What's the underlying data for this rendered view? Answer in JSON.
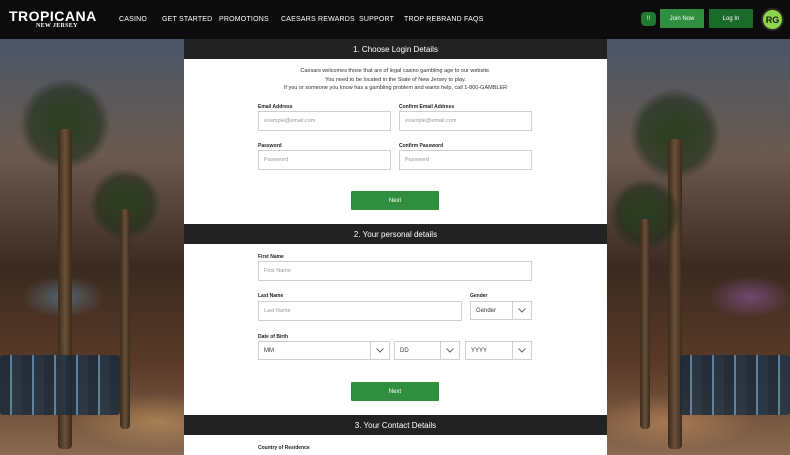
{
  "header": {
    "logo_text": "TROPICANA",
    "logo_subtext": "NEW JERSEY",
    "nav": [
      {
        "label": "CASINO"
      },
      {
        "label": "GET STARTED"
      },
      {
        "label": "PROMOTIONS"
      },
      {
        "label": "CAESARS REWARDS"
      },
      {
        "label": "SUPPORT"
      },
      {
        "label": "TROP REBRAND FAQS"
      }
    ],
    "region_badge": "!!",
    "join_label": "Join Now",
    "login_label": "Log In",
    "rg_label": "RG"
  },
  "section1": {
    "title": "1. Choose Login Details",
    "intro": [
      "Caesars welcomes those that are of legal casino gambling age to our website.",
      "You need to be located in the State of New Jersey to play.",
      "If you or someone you know has a gambling problem and wants help, call 1-800-GAMBLER"
    ],
    "email_label": "Email Address",
    "email_placeholder": "example@email.com",
    "confirm_email_label": "Confirm Email Address",
    "confirm_email_placeholder": "example@email.com",
    "password_label": "Password",
    "password_placeholder": "Password",
    "confirm_password_label": "Confirm Password",
    "confirm_password_placeholder": "Password",
    "next_label": "Next"
  },
  "section2": {
    "title": "2. Your personal details",
    "first_name_label": "First Name",
    "first_name_placeholder": "First Name",
    "last_name_label": "Last Name",
    "last_name_placeholder": "Last Name",
    "gender_label": "Gender",
    "gender_value": "Gender",
    "dob_label": "Date of Birth",
    "dob_month": "MM",
    "dob_day": "DD",
    "dob_year": "YYYY",
    "next_label": "Next"
  },
  "section3": {
    "title": "3. Your Contact Details",
    "country_label": "Country of Residence"
  },
  "colors": {
    "accent_green": "#2f8f3f",
    "header_bg": "#0c0c0c",
    "section_bg": "#222222"
  }
}
